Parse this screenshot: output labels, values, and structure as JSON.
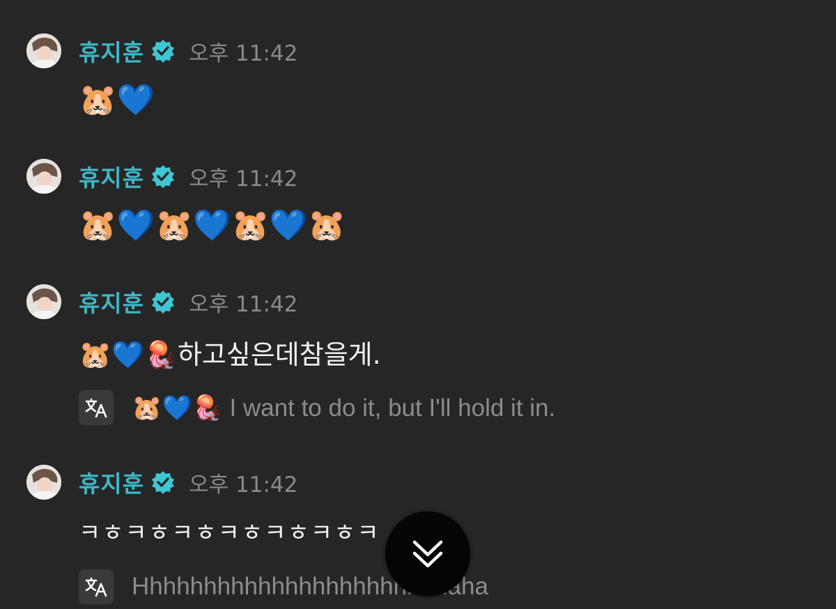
{
  "messages": [
    {
      "sender": "휴지훈",
      "time": "오후 11:42",
      "text": "🐹💙"
    },
    {
      "sender": "휴지훈",
      "time": "오후 11:42",
      "text": "🐹💙🐹💙🐹💙🐹"
    },
    {
      "sender": "휴지훈",
      "time": "오후 11:42",
      "text": "🐹💙🪼하고싶은데참을게.",
      "translation": "🐹💙🪼 I want to do it, but I'll hold it in."
    },
    {
      "sender": "휴지훈",
      "time": "오후 11:42",
      "text": "ㅋㅎㅋㅎㅋㅎㅋㅎㅋㅎㅋㅎㅋ",
      "translation": "Hhhhhhhhhhhhhhhhhhhhhhhaha"
    }
  ],
  "icons": {
    "verified": "verified-badge-icon",
    "translate": "translate-icon",
    "scroll_down": "double-chevron-down-icon"
  },
  "colors": {
    "background": "#262626",
    "sender": "#3fb6c6",
    "verified_badge": "#3fc6d3",
    "timestamp": "#8a8a8a",
    "translation_text": "#8c8c8c"
  }
}
